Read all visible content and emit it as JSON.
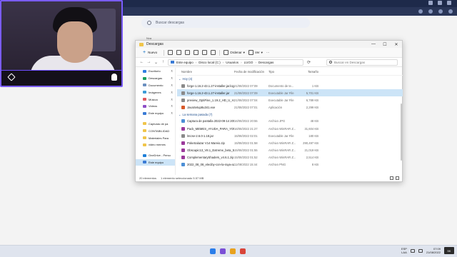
{
  "browser": {
    "search_placeholder": "Buscar descargas"
  },
  "window": {
    "tab_label": "Nva",
    "title": "Descargas",
    "controls": [
      "—",
      "☐",
      "✕"
    ],
    "toolbar": {
      "new_label": "Nuevo",
      "sort_label": "Ordenar",
      "view_label": "Ver"
    },
    "breadcrumb": [
      "Este equipo",
      "Disco local (C:)",
      "Usuarios",
      "LUGO",
      "Descargas"
    ],
    "search_placeholder": "Buscar en Descargas",
    "sidebar": [
      {
        "label": "Escritorio",
        "color": "#2f7de1",
        "pinned": true
      },
      {
        "label": "Descargas",
        "color": "#1a9e5c",
        "pinned": true
      },
      {
        "label": "Documento",
        "color": "#6b8fbf",
        "pinned": true
      },
      {
        "label": "Imágenes",
        "color": "#3c9bd6",
        "pinned": true
      },
      {
        "label": "Música",
        "color": "#e0575b",
        "pinned": true
      },
      {
        "label": "Videos",
        "color": "#8e4ec6",
        "pinned": true
      },
      {
        "label": "Este equipo",
        "color": "#3a7bd5",
        "pinned": true
      },
      {
        "label": "Capturas de pa",
        "color": "#f0c54a",
        "pinned": false
      },
      {
        "label": "CONTABILIDAD",
        "color": "#f0c54a",
        "pinned": false
      },
      {
        "label": "Materiales Para",
        "color": "#f0c54a",
        "pinned": false
      },
      {
        "label": "video memes",
        "color": "#f0c54a",
        "pinned": false
      },
      {
        "label": "OneDrive - Perso",
        "color": "#1e7fd8",
        "pinned": false
      },
      {
        "label": "Este equipo",
        "color": "#3a7bd5",
        "pinned": false
      }
    ],
    "columns": {
      "name": "Nombre",
      "date": "Fecha de modificación",
      "type": "Tipo",
      "size": "Tamaño"
    },
    "groups": [
      {
        "label": "Hoy (4)",
        "files": [
          {
            "name": "forge-1.16.2-43.1.27-installer.jar.log",
            "date": "21/08/2022 07:09",
            "type": "Documento de te...",
            "size": "1 KB",
            "color": "#8a8a8a",
            "selected": false
          },
          {
            "name": "forge-1.16.2-43.1.27-installer.jar",
            "date": "21/08/2022 07:09",
            "type": "Executable Jar File",
            "size": "5,701 KB",
            "color": "#8a8a8a",
            "selected": true
          },
          {
            "name": "preview_OptiFine_1.19.2_HD_U_H_pre2.jar",
            "date": "21/08/2022 07:04",
            "type": "Executable Jar File",
            "size": "6,789 KB",
            "color": "#8a8a8a",
            "selected": false
          },
          {
            "name": "JavaSetup8u341.exe",
            "date": "21/08/2022 07:01",
            "type": "Aplicación",
            "size": "2,299 KB",
            "color": "#d85a2a",
            "selected": false
          }
        ]
      },
      {
        "label": "La semana pasada (7)",
        "files": [
          {
            "name": "Captura de pantalla 2022-09-14 205532.jpg",
            "date": "16/08/2022 20:55",
            "type": "Archivo JPG",
            "size": "48 KB",
            "color": "#4d8fd6",
            "selected": false
          },
          {
            "name": "Pack_MEMES_AYUDA_PARA_YOUTUBERS...",
            "date": "16/08/2022 21:27",
            "type": "Archivo WinRAR Z...",
            "size": "31,604 KB",
            "color": "#9b3a9b",
            "selected": false
          },
          {
            "name": "lmcse-2.6.0-1.18.jar",
            "date": "15/08/2022 02:01",
            "type": "Executable Jar File",
            "size": "180 KB",
            "color": "#8a8a8a",
            "selected": false
          },
          {
            "name": "PokeSalazar V14 Mareio.zip",
            "date": "15/08/2022 01:58",
            "type": "Archivo WinRAR Z...",
            "size": "290,497 KB",
            "color": "#9b3a9b",
            "selected": false
          },
          {
            "name": "Obscapic13_V8.1_Extreme_beta_5.zip",
            "date": "15/08/2022 01:55",
            "type": "Archivo WinRAR Z...",
            "size": "21,019 KB",
            "color": "#9b3a9b",
            "selected": false
          },
          {
            "name": "ComplementaryShaders_v4.6.1.zip",
            "date": "15/08/2022 01:52",
            "type": "Archivo WinRAR Z...",
            "size": "2,514 KB",
            "color": "#9b3a9b",
            "selected": false
          },
          {
            "name": "2022_08_08_eleciby-con-la-raya-azul-200...",
            "date": "11/08/2022 15:44",
            "type": "Archivo PNG",
            "size": "8 KB",
            "color": "#4d8fd6",
            "selected": false
          }
        ]
      }
    ],
    "status": {
      "count": "20 elementos",
      "selection": "1 elemento seleccionado 5.57 MB"
    }
  },
  "taskbar": {
    "lang_top": "ESP",
    "lang_bottom": "LAA",
    "time": "07:09",
    "date": "21/08/2022",
    "logo_text": "5K"
  }
}
